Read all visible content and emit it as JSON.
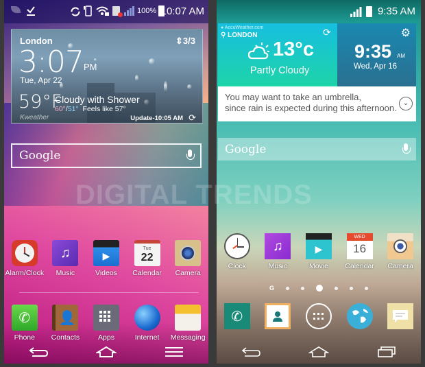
{
  "left_phone": {
    "status_bar": {
      "battery_percent": "100%",
      "time": "10:07 AM",
      "icons": [
        "leaf-icon",
        "download-icon",
        "sync-icon",
        "vibrate-icon",
        "wifi-lock-icon",
        "sim-error-icon",
        "signal-icon",
        "battery-charging-icon"
      ]
    },
    "weather_widget": {
      "city": "London",
      "page_indicator": "3/3",
      "time": "3:07",
      "ampm": "PM",
      "date": "Tue, Apr 22",
      "temperature": "59°F",
      "condition": "Cloudy with Shower",
      "high": "60°",
      "low": "51°",
      "feels_like": "Feels like 57°",
      "brand": "Kweather",
      "update": "Update-10:05 AM"
    },
    "search": {
      "logo": "Google"
    },
    "apps": [
      {
        "label": "Alarm/Clock",
        "icon": "alarm-clock-icon"
      },
      {
        "label": "Music",
        "icon": "music-icon"
      },
      {
        "label": "Videos",
        "icon": "videos-icon"
      },
      {
        "label": "Calendar",
        "icon": "calendar-icon",
        "day": "Tue",
        "date": "22"
      },
      {
        "label": "Camera",
        "icon": "camera-icon"
      }
    ],
    "dock": [
      {
        "label": "Phone",
        "icon": "phone-icon"
      },
      {
        "label": "Contacts",
        "icon": "contacts-icon"
      },
      {
        "label": "Apps",
        "icon": "apps-grid-icon"
      },
      {
        "label": "Internet",
        "icon": "globe-icon"
      },
      {
        "label": "Messaging",
        "icon": "messaging-icon"
      }
    ],
    "nav": [
      "back",
      "home",
      "menu"
    ]
  },
  "right_phone": {
    "status_bar": {
      "time": "9:35 AM",
      "icons": [
        "signal-icon",
        "battery-icon"
      ]
    },
    "weather_widget": {
      "source": "AccuWeather.com",
      "city": "LONDON",
      "temperature": "13°c",
      "condition": "Partly Cloudy",
      "time": "9:35",
      "ampm": "AM",
      "date": "Wed, Apr 16",
      "advice_line1": "You may want to take an umbrella,",
      "advice_line2": "since rain is expected during this afternoon."
    },
    "search": {
      "logo": "Google"
    },
    "apps": [
      {
        "label": "Clock",
        "icon": "clock-icon"
      },
      {
        "label": "Music",
        "icon": "music-icon"
      },
      {
        "label": "Movie",
        "icon": "movie-icon"
      },
      {
        "label": "Calendar",
        "icon": "calendar-icon",
        "day": "WED",
        "date": "16"
      },
      {
        "label": "Camera",
        "icon": "camera-icon"
      }
    ],
    "page_dots": {
      "count": 6,
      "active": 3,
      "google_page": "G"
    },
    "dock": [
      {
        "label": "",
        "icon": "phone-icon"
      },
      {
        "label": "",
        "icon": "contacts-icon"
      },
      {
        "label": "",
        "icon": "apps-grid-icon"
      },
      {
        "label": "",
        "icon": "globe-icon"
      },
      {
        "label": "",
        "icon": "messaging-icon"
      }
    ],
    "nav": [
      "back",
      "home",
      "recent-apps"
    ]
  },
  "watermark": "DIGITAL TRENDS"
}
